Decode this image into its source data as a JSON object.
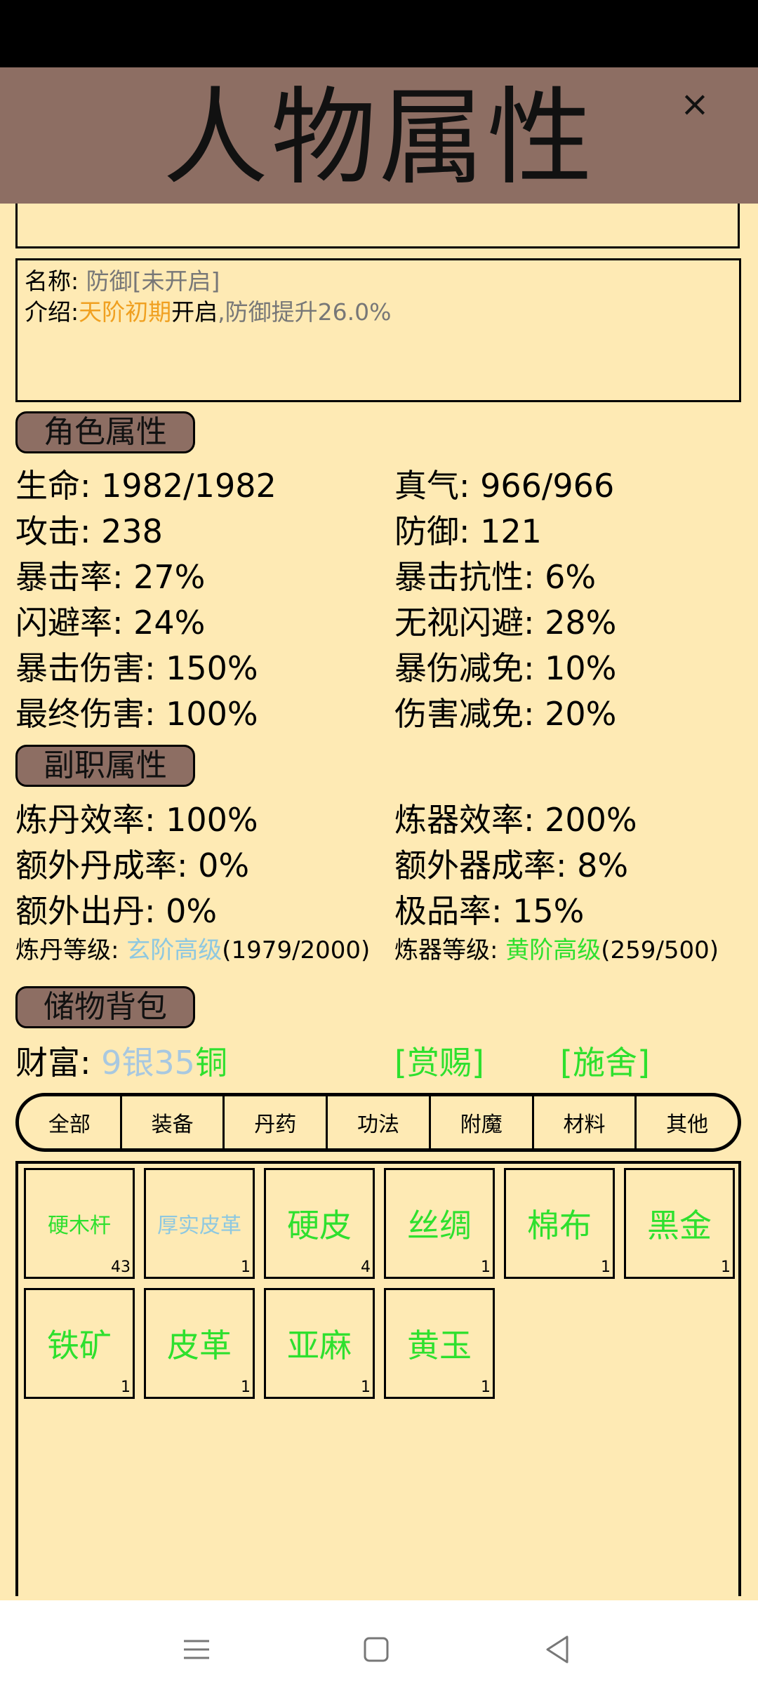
{
  "header": {
    "title": "人物属性",
    "close": "×"
  },
  "skill_info": {
    "name_label": "名称:",
    "name_value": "防御[未开启]",
    "intro_label": "介绍:",
    "intro_highlight": "天阶初期",
    "intro_open": "开启",
    "intro_rest": ",防御提升26.0%"
  },
  "sections": {
    "character": "角色属性",
    "secondary": "副职属性",
    "storage": "储物背包"
  },
  "character_stats": {
    "left": [
      "生命: 1982/1982",
      "攻击: 238",
      "暴击率: 27%",
      "闪避率: 24%",
      "暴击伤害: 150%",
      "最终伤害: 100%"
    ],
    "right": [
      "真气: 966/966",
      "防御: 121",
      "暴击抗性: 6%",
      "无视闪避: 28%",
      "暴伤减免: 10%",
      "伤害减免: 20%"
    ]
  },
  "secondary_stats": {
    "left": [
      "炼丹效率: 100%",
      "额外丹成率: 0%",
      "额外出丹: 0%"
    ],
    "right": [
      "炼器效率: 200%",
      "额外器成率: 8%",
      "极品率: 15%"
    ],
    "alchemy_level_label": "炼丹等级:",
    "alchemy_level_tier": "玄阶高级",
    "alchemy_level_progress": "(1979/2000)",
    "forge_level_label": "炼器等级:",
    "forge_level_tier": "黄阶高级",
    "forge_level_progress": "(259/500)"
  },
  "wealth": {
    "label": "财富:",
    "silver": "9",
    "silver_unit": "银",
    "copper": "35",
    "copper_unit": "铜",
    "reward_link": "[赏赐]",
    "donate_link": "[施舍]"
  },
  "tabs": [
    "全部",
    "装备",
    "丹药",
    "功法",
    "附魔",
    "材料",
    "其他"
  ],
  "items": [
    {
      "name": "硬木杆",
      "count": "43"
    },
    {
      "name": "厚实皮革",
      "count": "1"
    },
    {
      "name": "硬皮",
      "count": "4"
    },
    {
      "name": "丝绸",
      "count": "1"
    },
    {
      "name": "棉布",
      "count": "1"
    },
    {
      "name": "黑金",
      "count": "1"
    },
    {
      "name": "铁矿",
      "count": "1"
    },
    {
      "name": "皮革",
      "count": "1"
    },
    {
      "name": "亚麻",
      "count": "1"
    },
    {
      "name": "黄玉",
      "count": "1"
    }
  ],
  "colors": {
    "background": "#FEEAB4",
    "header": "#8D6E63",
    "green": "#2EE02E",
    "blue": "#8EC8E0",
    "orange": "#F0A020"
  },
  "nav_icons": [
    "menu-icon",
    "home-icon",
    "back-icon"
  ]
}
